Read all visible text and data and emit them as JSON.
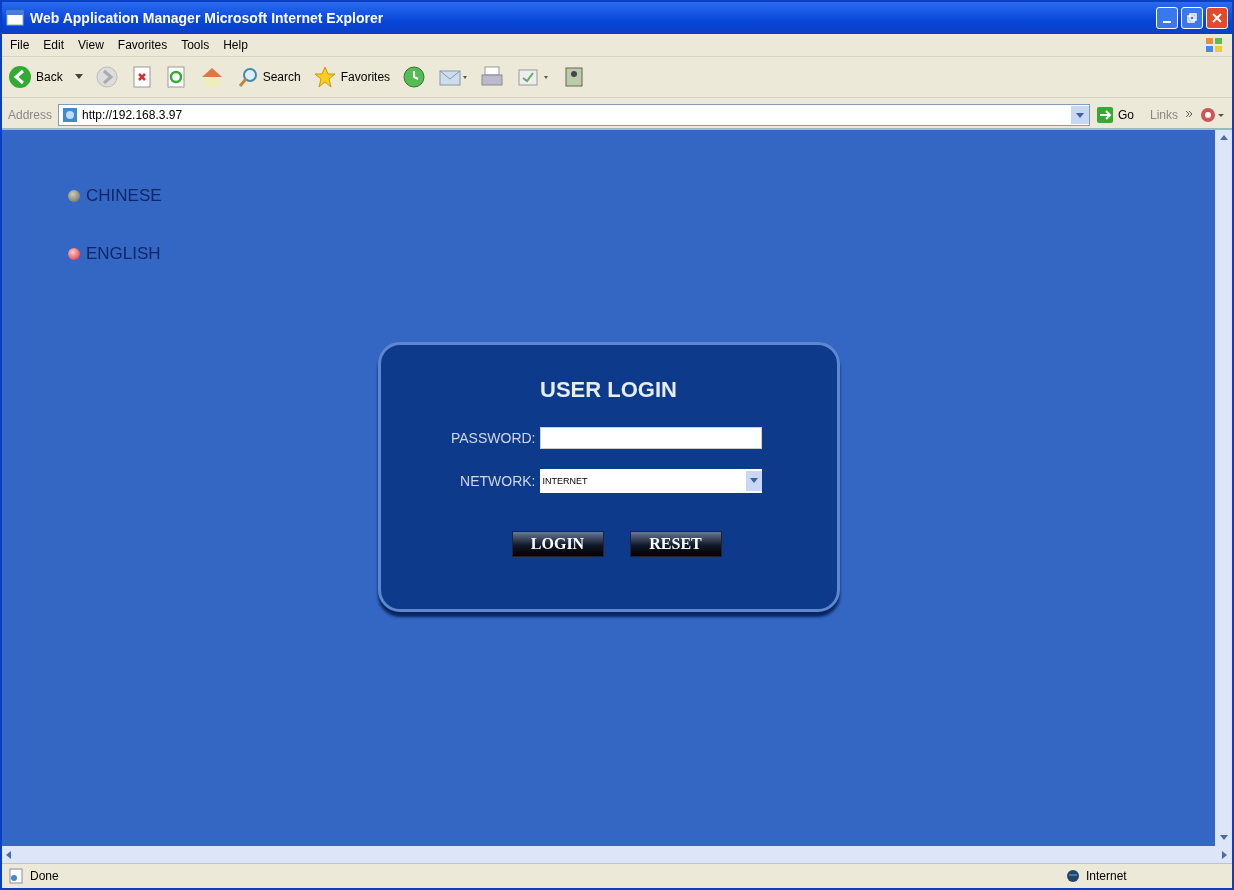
{
  "window": {
    "title": "Web Application Manager  Microsoft Internet Explorer"
  },
  "menu": [
    "File",
    "Edit",
    "View",
    "Favorites",
    "Tools",
    "Help"
  ],
  "toolbar": {
    "back": "Back",
    "search": "Search",
    "favorites": "Favorites"
  },
  "address_bar": {
    "label": "Address",
    "url": "http://192.168.3.97",
    "go": "Go",
    "links": "Links"
  },
  "languages": [
    {
      "label": "CHINESE",
      "selected": false
    },
    {
      "label": "ENGLISH",
      "selected": true
    }
  ],
  "login": {
    "title": "USER LOGIN",
    "password_label": "PASSWORD:",
    "network_label": "NETWORK:",
    "network_value": "INTERNET",
    "buttons": [
      "LOGIN",
      "RESET"
    ]
  },
  "status_bar": {
    "status": "Done",
    "zone": "Internet"
  }
}
